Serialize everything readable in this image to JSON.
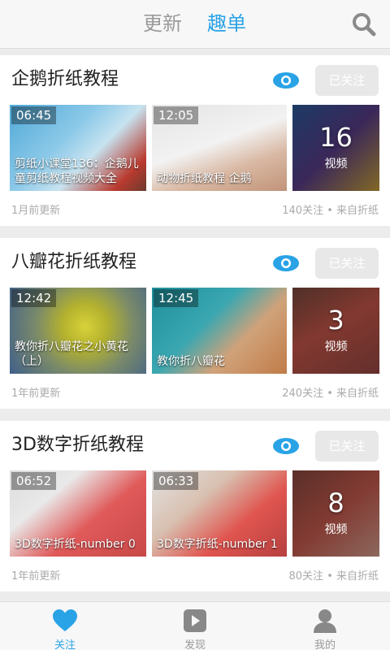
{
  "header": {
    "tabs": [
      {
        "label": "更新",
        "active": false
      },
      {
        "label": "趣单",
        "active": true
      }
    ],
    "search_icon": "search-icon"
  },
  "colors": {
    "accent": "#2aa3e6",
    "follow_bg": "#e8e8e8",
    "meta_text": "#aaaaaa"
  },
  "cards": [
    {
      "title": "企鹅折纸教程",
      "follow_label": "已关注",
      "videos": [
        {
          "duration": "06:45",
          "title": "剪纸小课堂136：企鹅儿童剪纸教程视频大全"
        },
        {
          "duration": "12:05",
          "title": "动物折纸教程 企鹅"
        }
      ],
      "more": {
        "count": "16",
        "label": "视频"
      },
      "updated": "1月前更新",
      "meta": "140关注 • 来自折纸"
    },
    {
      "title": "八瓣花折纸教程",
      "follow_label": "已关注",
      "videos": [
        {
          "duration": "12:42",
          "title": "教你折八瓣花之小黄花（上）"
        },
        {
          "duration": "12:45",
          "title": "教你折八瓣花"
        }
      ],
      "more": {
        "count": "3",
        "label": "视频"
      },
      "updated": "1年前更新",
      "meta": "240关注 • 来自折纸"
    },
    {
      "title": "3D数字折纸教程",
      "follow_label": "已关注",
      "videos": [
        {
          "duration": "06:52",
          "title": "3D数字折纸-number 0"
        },
        {
          "duration": "06:33",
          "title": "3D数字折纸-number 1"
        }
      ],
      "more": {
        "count": "8",
        "label": "视频"
      },
      "updated": "1年前更新",
      "meta": "80关注 • 来自折纸"
    }
  ],
  "bottom_nav": [
    {
      "label": "关注",
      "icon": "heart-icon",
      "active": true
    },
    {
      "label": "发现",
      "icon": "play-icon",
      "active": false
    },
    {
      "label": "我的",
      "icon": "person-icon",
      "active": false
    }
  ]
}
